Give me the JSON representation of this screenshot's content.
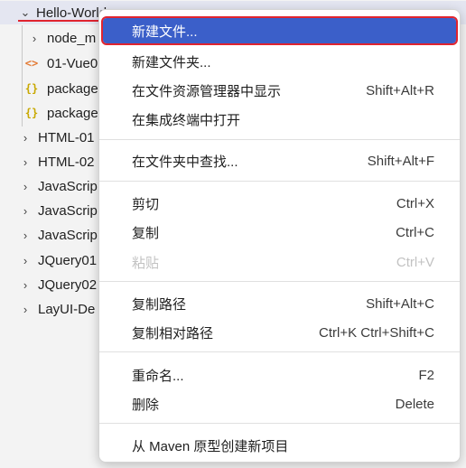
{
  "explorer": {
    "root": {
      "label": "Hello-World"
    },
    "items": [
      {
        "chevron": ">",
        "icon": "",
        "label": "node_m"
      },
      {
        "chevron": "",
        "icon": "<>",
        "label": "01-Vue0"
      },
      {
        "chevron": "",
        "icon": "{}",
        "label": "package"
      },
      {
        "chevron": "",
        "icon": "{}",
        "label": "package"
      },
      {
        "chevron": ">",
        "icon": "",
        "label": "HTML-01"
      },
      {
        "chevron": ">",
        "icon": "",
        "label": "HTML-02"
      },
      {
        "chevron": ">",
        "icon": "",
        "label": "JavaScrip"
      },
      {
        "chevron": ">",
        "icon": "",
        "label": "JavaScrip"
      },
      {
        "chevron": ">",
        "icon": "",
        "label": "JavaScrip"
      },
      {
        "chevron": ">",
        "icon": "",
        "label": "JQuery01"
      },
      {
        "chevron": ">",
        "icon": "",
        "label": "JQuery02"
      },
      {
        "chevron": ">",
        "icon": "",
        "label": "LayUI-De"
      }
    ]
  },
  "context_menu": {
    "items": [
      {
        "label": "新建文件...",
        "shortcut": ""
      },
      {
        "label": "新建文件夹...",
        "shortcut": ""
      },
      {
        "label": "在文件资源管理器中显示",
        "shortcut": "Shift+Alt+R"
      },
      {
        "label": "在集成终端中打开",
        "shortcut": ""
      },
      {
        "label": "在文件夹中查找...",
        "shortcut": "Shift+Alt+F"
      },
      {
        "label": "剪切",
        "shortcut": "Ctrl+X"
      },
      {
        "label": "复制",
        "shortcut": "Ctrl+C"
      },
      {
        "label": "粘贴",
        "shortcut": "Ctrl+V"
      },
      {
        "label": "复制路径",
        "shortcut": "Shift+Alt+C"
      },
      {
        "label": "复制相对路径",
        "shortcut": "Ctrl+K Ctrl+Shift+C"
      },
      {
        "label": "重命名...",
        "shortcut": "F2"
      },
      {
        "label": "删除",
        "shortcut": "Delete"
      },
      {
        "label": "从 Maven 原型创建新项目",
        "shortcut": ""
      }
    ]
  },
  "colors": {
    "highlight": "#3b5fc9",
    "annotation_red": "#e0242f"
  }
}
